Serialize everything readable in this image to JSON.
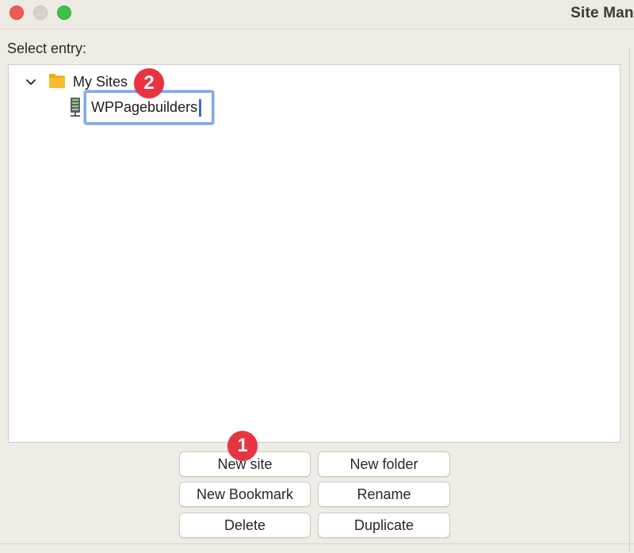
{
  "window": {
    "title": "Site Man"
  },
  "panel": {
    "select_label": "Select entry:"
  },
  "tree": {
    "folder_label": "My Sites",
    "site_name_value": "WPPagebuilders"
  },
  "annotations": {
    "badge_1": "1",
    "badge_2": "2"
  },
  "buttons": {
    "new_site": "New site",
    "new_folder": "New folder",
    "new_bookmark": "New Bookmark",
    "rename": "Rename",
    "delete": "Delete",
    "duplicate": "Duplicate"
  },
  "icons": {
    "folder": "folder-icon",
    "server": "server-icon",
    "chevron": "chevron-down-icon"
  },
  "colors": {
    "badge": "#e93340",
    "focus_ring": "#7fa8f0",
    "caret": "#2f6fe0"
  }
}
